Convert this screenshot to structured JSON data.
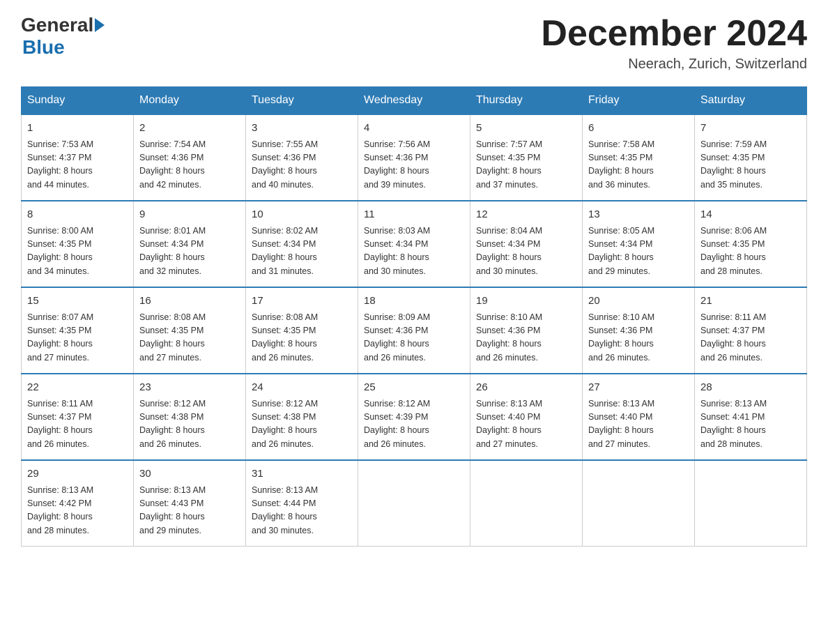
{
  "header": {
    "logo_general": "General",
    "logo_blue": "Blue",
    "month_title": "December 2024",
    "location": "Neerach, Zurich, Switzerland"
  },
  "days_of_week": [
    "Sunday",
    "Monday",
    "Tuesday",
    "Wednesday",
    "Thursday",
    "Friday",
    "Saturday"
  ],
  "weeks": [
    [
      {
        "num": "1",
        "sunrise": "7:53 AM",
        "sunset": "4:37 PM",
        "daylight": "8 hours and 44 minutes."
      },
      {
        "num": "2",
        "sunrise": "7:54 AM",
        "sunset": "4:36 PM",
        "daylight": "8 hours and 42 minutes."
      },
      {
        "num": "3",
        "sunrise": "7:55 AM",
        "sunset": "4:36 PM",
        "daylight": "8 hours and 40 minutes."
      },
      {
        "num": "4",
        "sunrise": "7:56 AM",
        "sunset": "4:36 PM",
        "daylight": "8 hours and 39 minutes."
      },
      {
        "num": "5",
        "sunrise": "7:57 AM",
        "sunset": "4:35 PM",
        "daylight": "8 hours and 37 minutes."
      },
      {
        "num": "6",
        "sunrise": "7:58 AM",
        "sunset": "4:35 PM",
        "daylight": "8 hours and 36 minutes."
      },
      {
        "num": "7",
        "sunrise": "7:59 AM",
        "sunset": "4:35 PM",
        "daylight": "8 hours and 35 minutes."
      }
    ],
    [
      {
        "num": "8",
        "sunrise": "8:00 AM",
        "sunset": "4:35 PM",
        "daylight": "8 hours and 34 minutes."
      },
      {
        "num": "9",
        "sunrise": "8:01 AM",
        "sunset": "4:34 PM",
        "daylight": "8 hours and 32 minutes."
      },
      {
        "num": "10",
        "sunrise": "8:02 AM",
        "sunset": "4:34 PM",
        "daylight": "8 hours and 31 minutes."
      },
      {
        "num": "11",
        "sunrise": "8:03 AM",
        "sunset": "4:34 PM",
        "daylight": "8 hours and 30 minutes."
      },
      {
        "num": "12",
        "sunrise": "8:04 AM",
        "sunset": "4:34 PM",
        "daylight": "8 hours and 30 minutes."
      },
      {
        "num": "13",
        "sunrise": "8:05 AM",
        "sunset": "4:34 PM",
        "daylight": "8 hours and 29 minutes."
      },
      {
        "num": "14",
        "sunrise": "8:06 AM",
        "sunset": "4:35 PM",
        "daylight": "8 hours and 28 minutes."
      }
    ],
    [
      {
        "num": "15",
        "sunrise": "8:07 AM",
        "sunset": "4:35 PM",
        "daylight": "8 hours and 27 minutes."
      },
      {
        "num": "16",
        "sunrise": "8:08 AM",
        "sunset": "4:35 PM",
        "daylight": "8 hours and 27 minutes."
      },
      {
        "num": "17",
        "sunrise": "8:08 AM",
        "sunset": "4:35 PM",
        "daylight": "8 hours and 26 minutes."
      },
      {
        "num": "18",
        "sunrise": "8:09 AM",
        "sunset": "4:36 PM",
        "daylight": "8 hours and 26 minutes."
      },
      {
        "num": "19",
        "sunrise": "8:10 AM",
        "sunset": "4:36 PM",
        "daylight": "8 hours and 26 minutes."
      },
      {
        "num": "20",
        "sunrise": "8:10 AM",
        "sunset": "4:36 PM",
        "daylight": "8 hours and 26 minutes."
      },
      {
        "num": "21",
        "sunrise": "8:11 AM",
        "sunset": "4:37 PM",
        "daylight": "8 hours and 26 minutes."
      }
    ],
    [
      {
        "num": "22",
        "sunrise": "8:11 AM",
        "sunset": "4:37 PM",
        "daylight": "8 hours and 26 minutes."
      },
      {
        "num": "23",
        "sunrise": "8:12 AM",
        "sunset": "4:38 PM",
        "daylight": "8 hours and 26 minutes."
      },
      {
        "num": "24",
        "sunrise": "8:12 AM",
        "sunset": "4:38 PM",
        "daylight": "8 hours and 26 minutes."
      },
      {
        "num": "25",
        "sunrise": "8:12 AM",
        "sunset": "4:39 PM",
        "daylight": "8 hours and 26 minutes."
      },
      {
        "num": "26",
        "sunrise": "8:13 AM",
        "sunset": "4:40 PM",
        "daylight": "8 hours and 27 minutes."
      },
      {
        "num": "27",
        "sunrise": "8:13 AM",
        "sunset": "4:40 PM",
        "daylight": "8 hours and 27 minutes."
      },
      {
        "num": "28",
        "sunrise": "8:13 AM",
        "sunset": "4:41 PM",
        "daylight": "8 hours and 28 minutes."
      }
    ],
    [
      {
        "num": "29",
        "sunrise": "8:13 AM",
        "sunset": "4:42 PM",
        "daylight": "8 hours and 28 minutes."
      },
      {
        "num": "30",
        "sunrise": "8:13 AM",
        "sunset": "4:43 PM",
        "daylight": "8 hours and 29 minutes."
      },
      {
        "num": "31",
        "sunrise": "8:13 AM",
        "sunset": "4:44 PM",
        "daylight": "8 hours and 30 minutes."
      },
      null,
      null,
      null,
      null
    ]
  ],
  "labels": {
    "sunrise_prefix": "Sunrise: ",
    "sunset_prefix": "Sunset: ",
    "daylight_prefix": "Daylight: "
  }
}
